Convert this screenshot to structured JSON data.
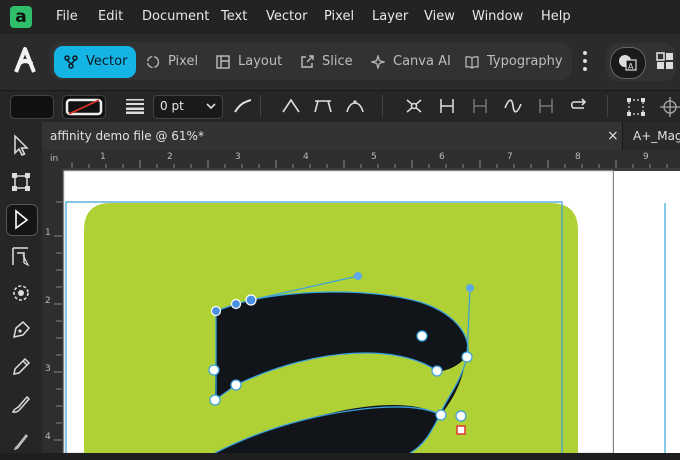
{
  "app": {
    "logo_letter": "a",
    "accent": "#14b4e4",
    "brand_green": "#2fbf6b"
  },
  "menu": [
    "File",
    "Edit",
    "Document",
    "Text",
    "Vector",
    "Pixel",
    "Layer",
    "View",
    "Window",
    "Help"
  ],
  "personas": [
    {
      "label": "Vector",
      "icon": "vector-pen-icon"
    },
    {
      "label": "Pixel",
      "icon": "pixel-circle-icon"
    },
    {
      "label": "Layout",
      "icon": "layout-icon"
    },
    {
      "label": "Slice",
      "icon": "slice-export-icon"
    },
    {
      "label": "Canva AI",
      "icon": "sparkle-icon"
    },
    {
      "label": "Typography",
      "icon": "book-icon"
    }
  ],
  "context": {
    "stroke_width": "0 pt"
  },
  "tabs": [
    {
      "label": "affinity demo file @ 61%*",
      "close": "×"
    },
    {
      "label": "A+_Maga"
    }
  ],
  "ruler": {
    "unit": "in",
    "h_ticks": [
      "1",
      "2",
      "3",
      "4",
      "5",
      "6",
      "7",
      "8",
      "9"
    ],
    "v_ticks": [
      "1",
      "2",
      "3",
      "4"
    ]
  },
  "document": {
    "artboard_bg": "#ffffff",
    "tile_color": "#b0d136",
    "glyph_color": "#111418"
  }
}
